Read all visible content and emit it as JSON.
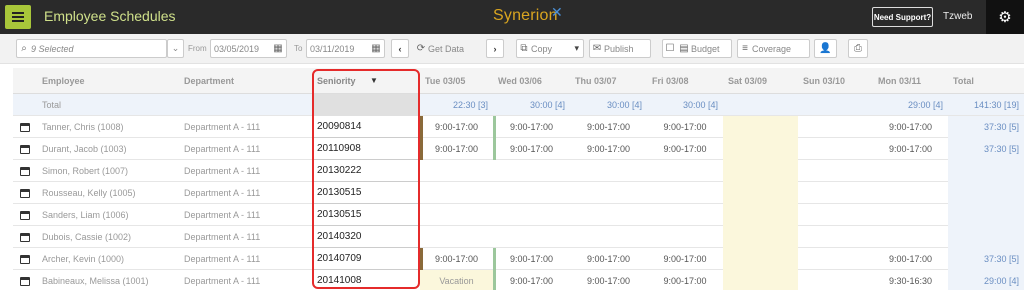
{
  "header": {
    "title": "Employee Schedules",
    "logo_text": "Synerion",
    "support_label": "Need Support?",
    "user": "Tzweb"
  },
  "toolbar": {
    "employee_select": "9 Selected",
    "from_label": "From",
    "from_date": "03/05/2019",
    "to_label": "To",
    "to_date": "03/11/2019",
    "get_data": "Get Data",
    "copy": "Copy",
    "publish": "Publish",
    "budget": "Budget",
    "coverage": "Coverage"
  },
  "table": {
    "columns": {
      "employee": "Employee",
      "department": "Department",
      "seniority": "Seniority",
      "tue": "Tue 03/05",
      "wed": "Wed 03/06",
      "thu": "Thu 03/07",
      "fri": "Fri 03/08",
      "sat": "Sat 03/09",
      "sun": "Sun 03/10",
      "mon": "Mon 03/11",
      "total": "Total"
    },
    "total_row": {
      "label": "Total",
      "tue": "22:30 [3]",
      "wed": "30:00 [4]",
      "thu": "30:00 [4]",
      "fri": "30:00 [4]",
      "mon": "29:00 [4]",
      "total": "141:30 [19]"
    },
    "rows": [
      {
        "employee": "Tanner, Chris (1008)",
        "department": "Department A - 111",
        "seniority": "20090814",
        "tue": "9:00-17:00",
        "wed": "9:00-17:00",
        "thu": "9:00-17:00",
        "fri": "9:00-17:00",
        "mon": "9:00-17:00",
        "total": "37:30 [5]"
      },
      {
        "employee": "Durant, Jacob (1003)",
        "department": "Department A - 111",
        "seniority": "20110908",
        "tue": "9:00-17:00",
        "wed": "9:00-17:00",
        "thu": "9:00-17:00",
        "fri": "9:00-17:00",
        "mon": "9:00-17:00",
        "total": "37:30 [5]"
      },
      {
        "employee": "Simon, Robert (1007)",
        "department": "Department A - 111",
        "seniority": "20130222",
        "tue": "",
        "wed": "",
        "thu": "",
        "fri": "",
        "mon": "",
        "total": ""
      },
      {
        "employee": "Rousseau, Kelly (1005)",
        "department": "Department A - 111",
        "seniority": "20130515",
        "tue": "",
        "wed": "",
        "thu": "",
        "fri": "",
        "mon": "",
        "total": ""
      },
      {
        "employee": "Sanders, Liam (1006)",
        "department": "Department A - 111",
        "seniority": "20130515",
        "tue": "",
        "wed": "",
        "thu": "",
        "fri": "",
        "mon": "",
        "total": ""
      },
      {
        "employee": "Dubois, Cassie (1002)",
        "department": "Department A - 111",
        "seniority": "20140320",
        "tue": "",
        "wed": "",
        "thu": "",
        "fri": "",
        "mon": "",
        "total": ""
      },
      {
        "employee": "Archer, Kevin (1000)",
        "department": "Department A - 111",
        "seniority": "20140709",
        "tue": "9:00-17:00",
        "wed": "9:00-17:00",
        "thu": "9:00-17:00",
        "fri": "9:00-17:00",
        "mon": "9:00-17:00",
        "total": "37:30 [5]"
      },
      {
        "employee": "Babineaux, Melissa (1001)",
        "department": "Department A - 111",
        "seniority": "20141008",
        "tue": "Vacation",
        "wed": "9:00-17:00",
        "thu": "9:00-17:00",
        "fri": "9:00-17:00",
        "mon": "9:30-16:30",
        "total": "29:00 [4]"
      }
    ]
  },
  "colors": {
    "accent": "#a8c63a",
    "highlight": "#e52b2b",
    "total_blue": "#6a8ec2",
    "weekend": "#fbf7dc"
  }
}
